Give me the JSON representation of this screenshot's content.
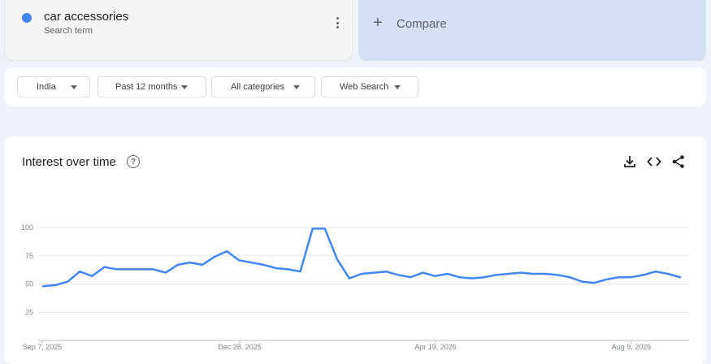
{
  "search_term": {
    "name": "car accessories",
    "subtitle": "Search term",
    "color": "#4285f4"
  },
  "compare": {
    "label": "Compare"
  },
  "filters": {
    "region": "India",
    "time": "Past 12 months",
    "category": "All categories",
    "source": "Web Search"
  },
  "chart_panel": {
    "title": "Interest over time",
    "icons": [
      "help-icon",
      "download-icon",
      "embed-icon",
      "share-icon"
    ]
  },
  "chart_data": {
    "type": "line",
    "ylim": [
      0,
      100
    ],
    "y_ticks": [
      25,
      50,
      75,
      100
    ],
    "x_tick_labels": [
      "Sep 7, 2025",
      "Dec 28, 2025",
      "Apr 19, 2026",
      "Aug 9, 2026"
    ],
    "grid": true,
    "series": [
      {
        "color": "#4285f4",
        "values": [
          48,
          49,
          52,
          61,
          57,
          65,
          63,
          63,
          63,
          63,
          60,
          67,
          69,
          67,
          74,
          79,
          71,
          69,
          67,
          64,
          63,
          61,
          99,
          99,
          72,
          55,
          59,
          60,
          61,
          58,
          56,
          60,
          57,
          59,
          56,
          55,
          56,
          58,
          59,
          60,
          59,
          59,
          58,
          56,
          52,
          51,
          54,
          56,
          56,
          58,
          61,
          59,
          56
        ]
      }
    ]
  }
}
